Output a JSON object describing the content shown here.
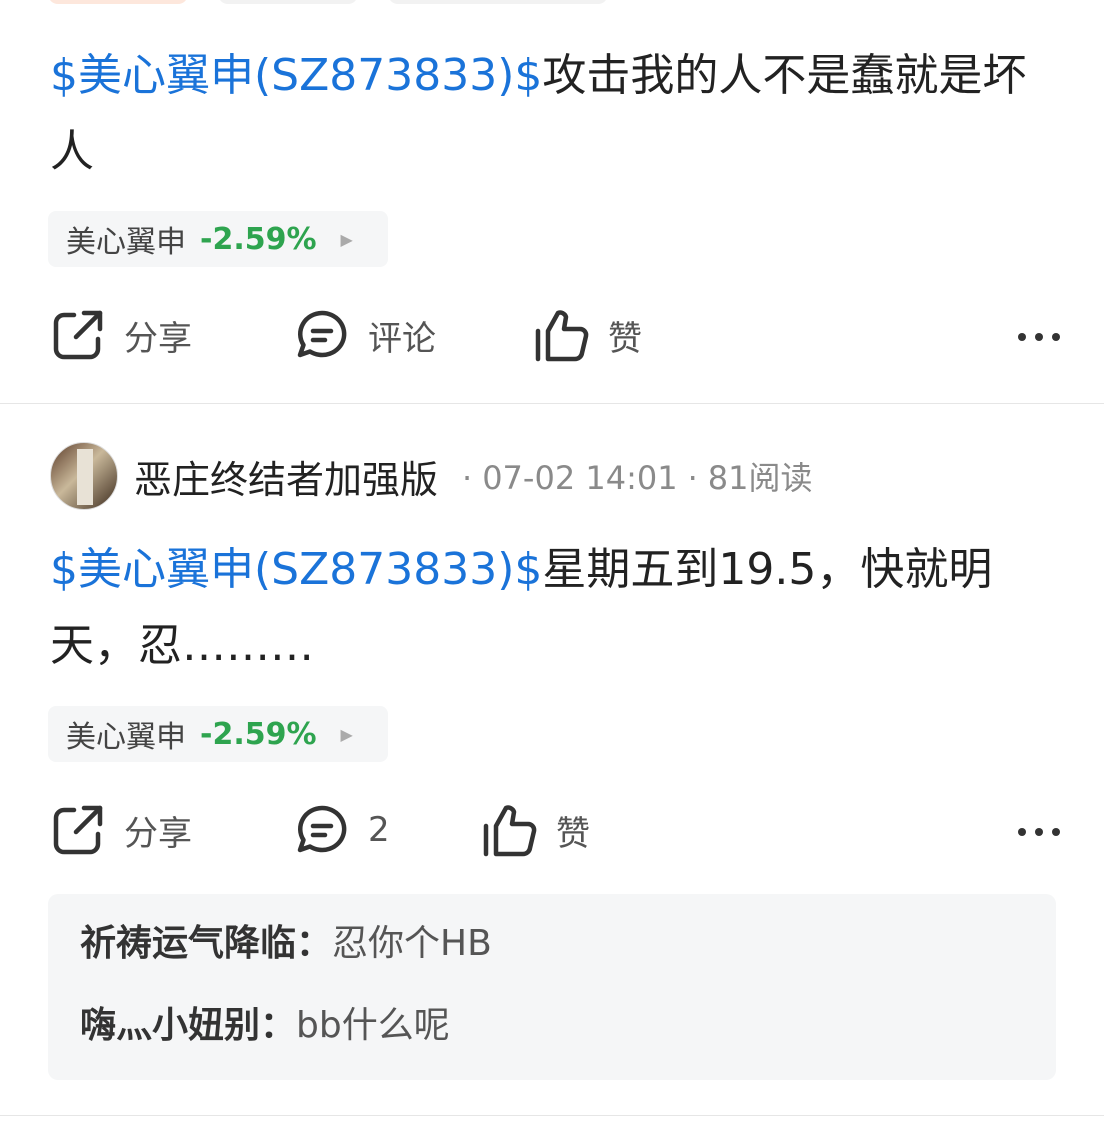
{
  "posts": [
    {
      "stock_link": "$美心翼申(SZ873833)$",
      "text": "攻击我的人不是蠢就是坏人",
      "stock_chip": {
        "name": "美心翼申",
        "change": "-2.59%"
      },
      "actions": {
        "share": "分享",
        "comment": "评论",
        "like": "赞"
      }
    },
    {
      "author": {
        "name": "恶庄终结者加强版",
        "date": "07-02 14:01",
        "reads": "81阅读"
      },
      "stock_link": "$美心翼申(SZ873833)$",
      "text": "星期五到19.5，快就明天，忍………",
      "stock_chip": {
        "name": "美心翼申",
        "change": "-2.59%"
      },
      "actions": {
        "share": "分享",
        "comment": "2",
        "like": "赞"
      },
      "comments": [
        {
          "user": "祈祷运气降临：",
          "text": "忍你个HB"
        },
        {
          "user": "嗨灬小妞别：",
          "text": "bb什么呢"
        }
      ]
    }
  ],
  "colors": {
    "link": "#1a73d9",
    "down": "#2ea44f",
    "chip_bg": "#f5f6f7"
  },
  "icons": [
    "share-icon",
    "comment-icon",
    "like-icon",
    "more-icon",
    "chevron-right-icon"
  ]
}
